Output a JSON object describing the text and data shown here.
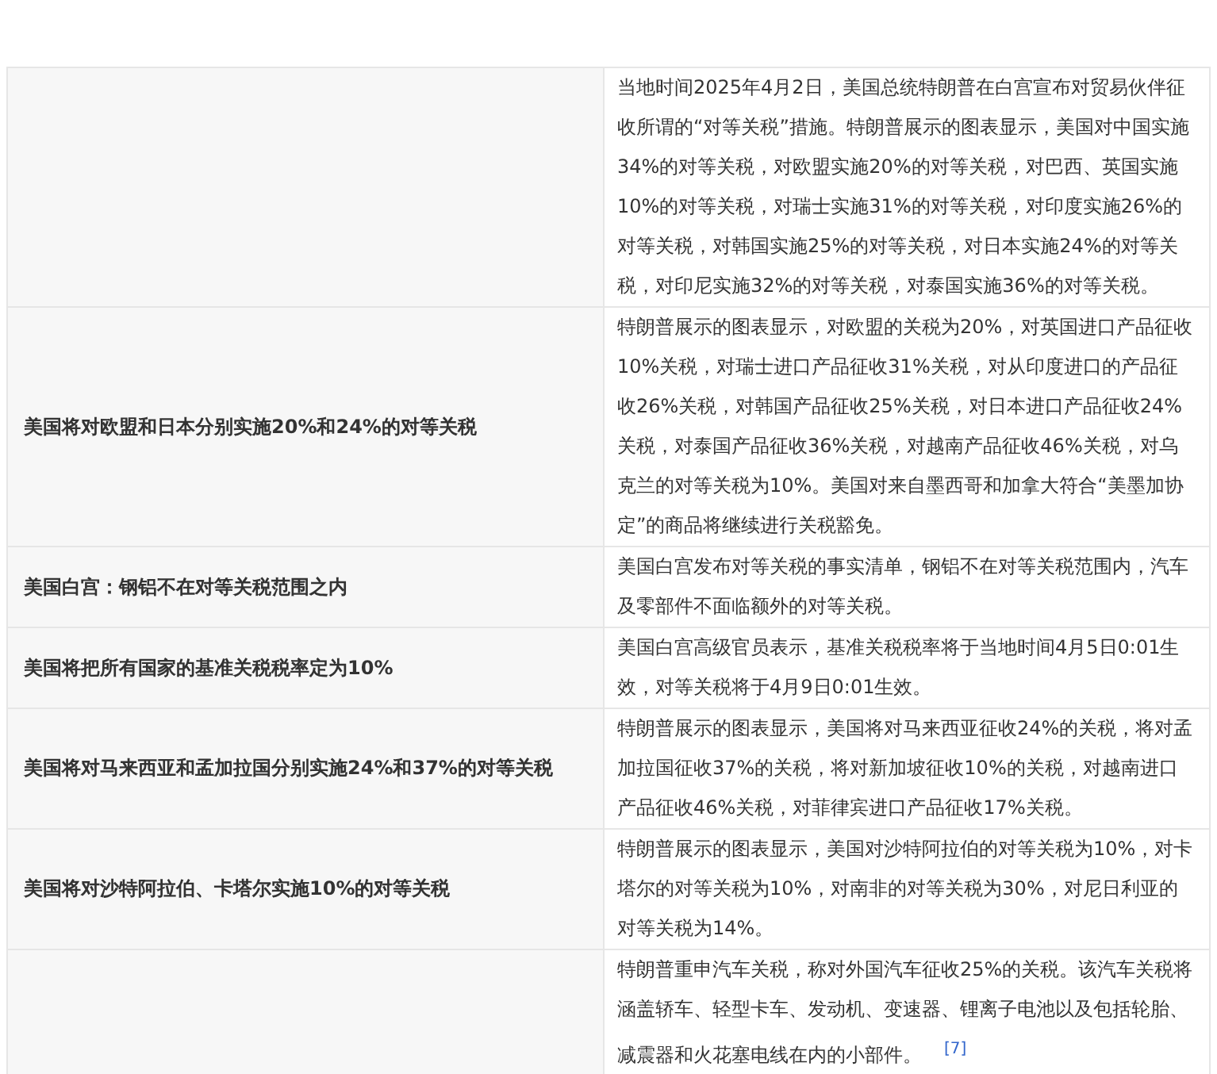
{
  "rows": [
    {
      "text": "当地时间2025年4月2日，美国总统特朗普在白宫宣布对贸易伙伴征收所谓的“对等关税”措施。特朗普展示的图表显示，美国对中国实施34%的对等关税，对欧盟实施20%的对等关税，对巴西、英国实施10%的对等关税，对瑞士实施31%的对等关税，对印度实施26%的对等关税，对韩国实施25%的对等关税，对日本实施24%的对等关税，对印尼实施32%的对等关税，对泰国实施36%的对等关税。"
    },
    {
      "heading": "美国将对欧盟和日本分别实施20%和24%的对等关税",
      "text": "特朗普展示的图表显示，对欧盟的关税为20%，对英国进口产品征收10%关税，对瑞士进口产品征收31%关税，对从印度进口的产品征收26%关税，对韩国产品征收25%关税，对日本进口产品征收24%关税，对泰国产品征收36%关税，对越南产品征收46%关税，对乌克兰的对等关税为10%。美国对来自墨西哥和加拿大符合“美墨加协定”的商品将继续进行关税豁免。"
    },
    {
      "heading": "美国白宫：钢铝不在对等关税范围之内",
      "text": "美国白宫发布对等关税的事实清单，钢铝不在对等关税范围内，汽车及零部件不面临额外的对等关税。"
    },
    {
      "heading": "美国将把所有国家的基准关税税率定为10%",
      "text": "美国白宫高级官员表示，基准关税税率将于当地时间4月5日0:01生效，对等关税将于4月9日0:01生效。"
    },
    {
      "heading": "美国将对马来西亚和孟加拉国分别实施24%和37%的对等关税",
      "text": "特朗普展示的图表显示，美国将对马来西亚征收24%的关税，将对孟加拉国征收37%的关税，将对新加坡征收10%的关税，对越南进口产品征收46%关税，对菲律宾进口产品征收17%关税。"
    },
    {
      "heading": "美国将对沙特阿拉伯、卡塔尔实施10%的对等关税",
      "text": "特朗普展示的图表显示，美国对沙特阿拉伯的对等关税为10%，对卡塔尔的对等关税为10%，对南非的对等关税为30%，对尼日利亚的对等关税为14%。"
    },
    {
      "text": "特朗普重申汽车关税，称对外国汽车征收25%的关税。该汽车关税将涵盖轿车、轻型卡车、发动机、变速器、锂离子电池以及包括轮胎、减震器和火花塞电线在内的小部件。",
      "citation": "[7]"
    }
  ]
}
